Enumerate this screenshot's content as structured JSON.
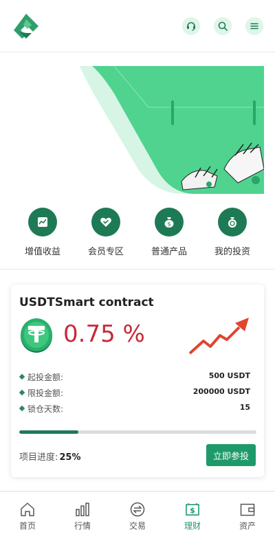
{
  "header": {
    "support_icon": "headset-icon",
    "search_icon": "search-icon",
    "menu_icon": "menu-icon"
  },
  "quicknav": [
    {
      "label": "增值收益",
      "icon": "chart-icon"
    },
    {
      "label": "会员专区",
      "icon": "heart-check-icon"
    },
    {
      "label": "普通产品",
      "icon": "money-bag-icon"
    },
    {
      "label": "我的投资",
      "icon": "coin-bag-icon"
    }
  ],
  "product": {
    "title": "USDTSmart contract",
    "rate": "0.75 %",
    "rows": [
      {
        "key": "起投金额:",
        "value": "500 USDT"
      },
      {
        "key": "限投金额:",
        "value": "200000 USDT"
      },
      {
        "key": "锁仓天数:",
        "value": "15"
      }
    ],
    "progress_label": "项目进度:",
    "progress_value": "25%",
    "progress_fraction": 0.25,
    "invest_button": "立即参投"
  },
  "tabbar": [
    {
      "label": "首页",
      "icon": "home-icon",
      "active": false
    },
    {
      "label": "行情",
      "icon": "bars-icon",
      "active": false
    },
    {
      "label": "交易",
      "icon": "exchange-icon",
      "active": false
    },
    {
      "label": "理财",
      "icon": "finance-icon",
      "active": true
    },
    {
      "label": "资产",
      "icon": "wallet-icon",
      "active": false
    }
  ],
  "colors": {
    "primary": "#1e7a55",
    "accent_button": "#1e9a6a",
    "rate_red": "#c8283a",
    "icon_bg_light": "#dff5ea"
  }
}
